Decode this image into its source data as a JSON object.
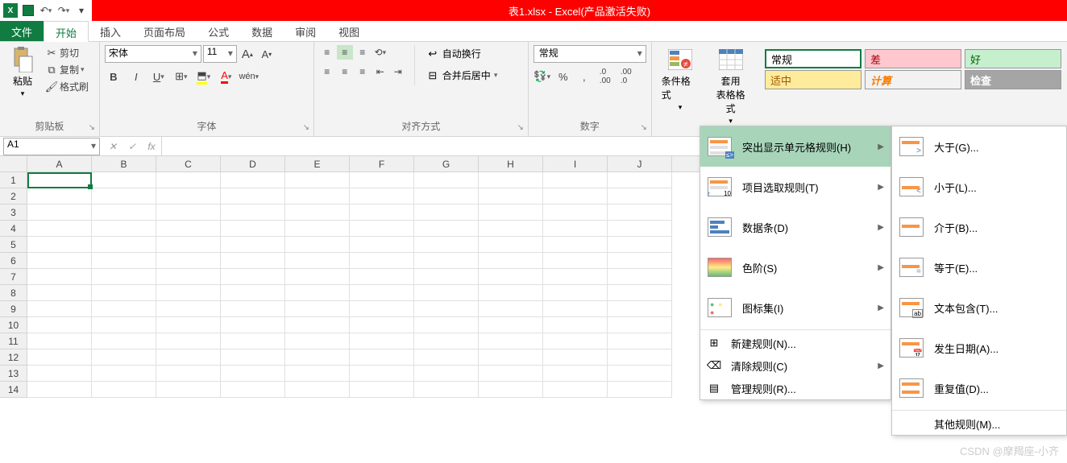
{
  "title": "表1.xlsx -  Excel(产品激活失败)",
  "tabs": {
    "file": "文件",
    "home": "开始",
    "insert": "插入",
    "layout": "页面布局",
    "formulas": "公式",
    "data": "数据",
    "review": "审阅",
    "view": "视图"
  },
  "clipboard": {
    "paste": "粘贴",
    "cut": "剪切",
    "copy": "复制",
    "painter": "格式刷",
    "label": "剪贴板"
  },
  "font": {
    "name": "宋体",
    "size": "11",
    "wen": "wén",
    "label": "字体"
  },
  "align": {
    "wrap": "自动换行",
    "merge": "合并后居中",
    "label": "对齐方式"
  },
  "number": {
    "format": "常规",
    "label": "数字"
  },
  "format": {
    "cf": "条件格式",
    "table": "套用\n表格格式"
  },
  "styles": {
    "normal": "常规",
    "bad": "差",
    "good": "好",
    "neutral": "适中",
    "calc": "计算",
    "check": "检查"
  },
  "namebox": "A1",
  "columns": [
    "A",
    "B",
    "C",
    "D",
    "E",
    "F",
    "G",
    "H",
    "I",
    "J"
  ],
  "rows": [
    1,
    2,
    3,
    4,
    5,
    6,
    7,
    8,
    9,
    10,
    11,
    12,
    13,
    14
  ],
  "menu1": {
    "highlight": "突出显示单元格规则(H)",
    "toprules": "项目选取规则(T)",
    "databars": "数据条(D)",
    "colorscales": "色阶(S)",
    "iconsets": "图标集(I)",
    "new": "新建规则(N)...",
    "clear": "清除规则(C)",
    "manage": "管理规则(R)..."
  },
  "menu2": {
    "greater": "大于(G)...",
    "less": "小于(L)...",
    "between": "介于(B)...",
    "equal": "等于(E)...",
    "textcontains": "文本包含(T)...",
    "dateoccurring": "发生日期(A)...",
    "duplicate": "重复值(D)...",
    "other": "其他规则(M)..."
  },
  "watermark": "CSDN @摩羯座-小齐"
}
